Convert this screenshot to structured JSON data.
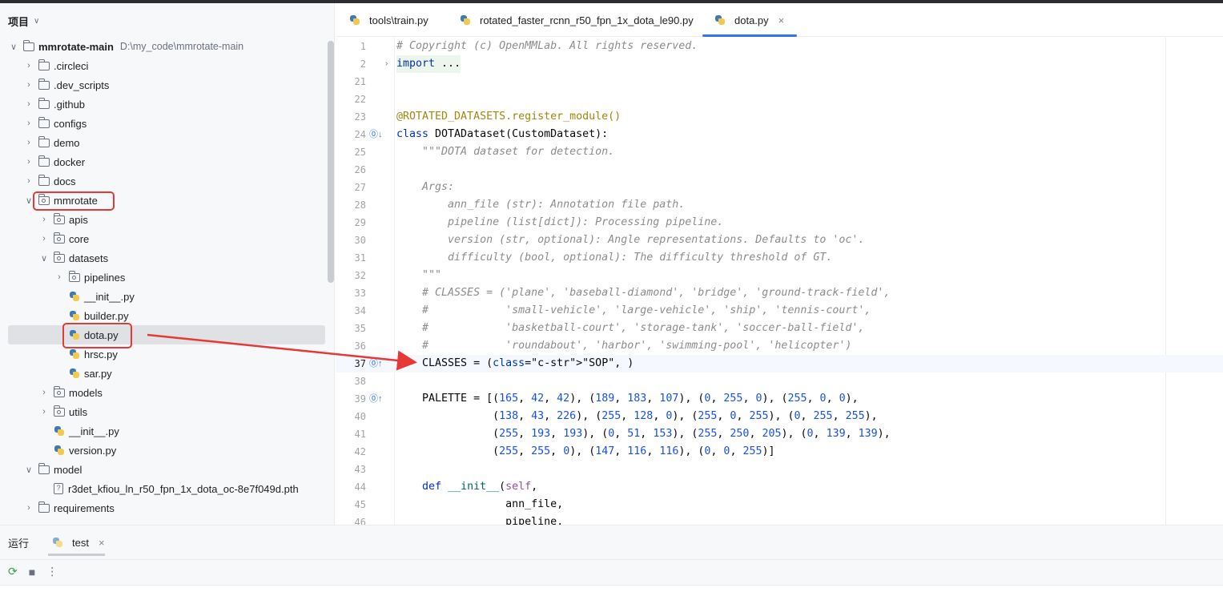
{
  "project_panel": {
    "title": "项目",
    "root": {
      "name": "mmrotate-main",
      "path": "D:\\my_code\\mmrotate-main"
    },
    "items": [
      {
        "label": "mmrotate-main",
        "kind": "folder",
        "depth": 0,
        "expanded": true
      },
      {
        "label": ".circleci",
        "kind": "folder",
        "depth": 1,
        "expanded": false
      },
      {
        "label": ".dev_scripts",
        "kind": "folder",
        "depth": 1,
        "expanded": false
      },
      {
        "label": ".github",
        "kind": "folder",
        "depth": 1,
        "expanded": false
      },
      {
        "label": "configs",
        "kind": "folder",
        "depth": 1,
        "expanded": false
      },
      {
        "label": "demo",
        "kind": "folder",
        "depth": 1,
        "expanded": false
      },
      {
        "label": "docker",
        "kind": "folder",
        "depth": 1,
        "expanded": false
      },
      {
        "label": "docs",
        "kind": "folder",
        "depth": 1,
        "expanded": false
      },
      {
        "label": "mmrotate",
        "kind": "package",
        "depth": 1,
        "expanded": true
      },
      {
        "label": "apis",
        "kind": "package",
        "depth": 2,
        "expanded": false
      },
      {
        "label": "core",
        "kind": "package",
        "depth": 2,
        "expanded": false
      },
      {
        "label": "datasets",
        "kind": "package",
        "depth": 2,
        "expanded": true
      },
      {
        "label": "pipelines",
        "kind": "package",
        "depth": 3,
        "expanded": false
      },
      {
        "label": "__init__.py",
        "kind": "py",
        "depth": 3
      },
      {
        "label": "builder.py",
        "kind": "py",
        "depth": 3
      },
      {
        "label": "dota.py",
        "kind": "py",
        "depth": 3,
        "selected": true
      },
      {
        "label": "hrsc.py",
        "kind": "py",
        "depth": 3
      },
      {
        "label": "sar.py",
        "kind": "py",
        "depth": 3
      },
      {
        "label": "models",
        "kind": "package",
        "depth": 2,
        "expanded": false
      },
      {
        "label": "utils",
        "kind": "package",
        "depth": 2,
        "expanded": false
      },
      {
        "label": "__init__.py",
        "kind": "py",
        "depth": 2
      },
      {
        "label": "version.py",
        "kind": "py",
        "depth": 2
      },
      {
        "label": "model",
        "kind": "folder",
        "depth": 1,
        "expanded": true
      },
      {
        "label": "r3det_kfiou_ln_r50_fpn_1x_dota_oc-8e7f049d.pth",
        "kind": "unknown",
        "depth": 2
      },
      {
        "label": "requirements",
        "kind": "folder",
        "depth": 1,
        "expanded": false
      }
    ]
  },
  "tabs": [
    {
      "label": "tools\\train.py",
      "active": false
    },
    {
      "label": "rotated_faster_rcnn_r50_fpn_1x_dota_le90.py",
      "active": false
    },
    {
      "label": "dota.py",
      "active": true
    }
  ],
  "tab_close_glyph": "×",
  "editor": {
    "current_line": "37",
    "lines": [
      {
        "n": "1",
        "code": "# Copyright (c) OpenMMLab. All rights reserved."
      },
      {
        "n": "2",
        "code": "import ..."
      },
      {
        "n": "21",
        "code": ""
      },
      {
        "n": "22",
        "code": ""
      },
      {
        "n": "23",
        "code": "@ROTATED_DATASETS.register_module()"
      },
      {
        "n": "24",
        "code": "class DOTADataset(CustomDataset):"
      },
      {
        "n": "25",
        "code": "    \"\"\"DOTA dataset for detection."
      },
      {
        "n": "26",
        "code": ""
      },
      {
        "n": "27",
        "code": "    Args:"
      },
      {
        "n": "28",
        "code": "        ann_file (str): Annotation file path."
      },
      {
        "n": "29",
        "code": "        pipeline (list[dict]): Processing pipeline."
      },
      {
        "n": "30",
        "code": "        version (str, optional): Angle representations. Defaults to 'oc'."
      },
      {
        "n": "31",
        "code": "        difficulty (bool, optional): The difficulty threshold of GT."
      },
      {
        "n": "32",
        "code": "    \"\"\""
      },
      {
        "n": "33",
        "code": "    # CLASSES = ('plane', 'baseball-diamond', 'bridge', 'ground-track-field',"
      },
      {
        "n": "34",
        "code": "    #            'small-vehicle', 'large-vehicle', 'ship', 'tennis-court',"
      },
      {
        "n": "35",
        "code": "    #            'basketball-court', 'storage-tank', 'soccer-ball-field',"
      },
      {
        "n": "36",
        "code": "    #            'roundabout', 'harbor', 'swimming-pool', 'helicopter')"
      },
      {
        "n": "37",
        "code": "    CLASSES = (\"SOP\", )"
      },
      {
        "n": "38",
        "code": ""
      },
      {
        "n": "39",
        "code": "    PALETTE = [(165, 42, 42), (189, 183, 107), (0, 255, 0), (255, 0, 0),"
      },
      {
        "n": "40",
        "code": "               (138, 43, 226), (255, 128, 0), (255, 0, 255), (0, 255, 255),"
      },
      {
        "n": "41",
        "code": "               (255, 193, 193), (0, 51, 153), (255, 250, 205), (0, 139, 139),"
      },
      {
        "n": "42",
        "code": "               (255, 255, 0), (147, 116, 116), (0, 0, 255)]"
      },
      {
        "n": "43",
        "code": ""
      },
      {
        "n": "44",
        "code": "    def __init__(self,"
      },
      {
        "n": "45",
        "code": "                 ann_file,"
      },
      {
        "n": "46",
        "code": "                 pipeline,"
      }
    ]
  },
  "run_panel": {
    "title": "运行",
    "tab_label": "test",
    "tab_close": "×"
  },
  "colors": {
    "annotation_red": "#e53935",
    "accent": "#3574f0"
  }
}
